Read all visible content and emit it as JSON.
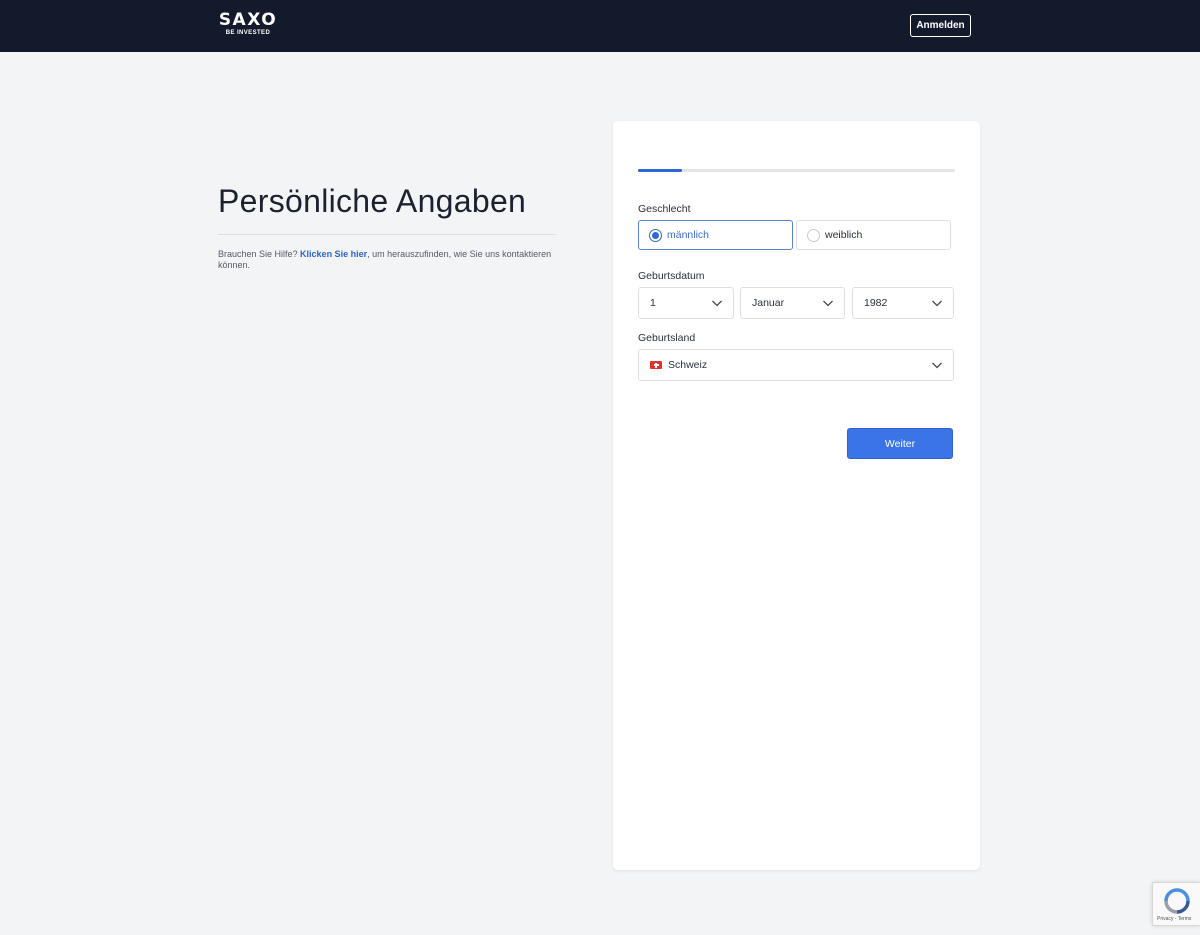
{
  "header": {
    "brand": "SAXO",
    "tagline": "BE INVESTED",
    "login_label": "Anmelden"
  },
  "intro": {
    "title": "Persönliche Angaben",
    "help_prefix": "Brauchen Sie Hilfe? ",
    "help_link": "Klicken Sie hier",
    "help_suffix": ", um herauszufinden, wie Sie uns kontaktieren können."
  },
  "form": {
    "progress": 0.14,
    "gender": {
      "label": "Geschlecht",
      "options": [
        "männlich",
        "weiblich"
      ],
      "selected": "männlich"
    },
    "birthdate": {
      "label": "Geburtsdatum",
      "day": "1",
      "month": "Januar",
      "year": "1982"
    },
    "birth_country": {
      "label": "Geburtsland",
      "value": "Schweiz",
      "flag": "swiss-flag-icon"
    },
    "next_label": "Weiter"
  },
  "recaptcha": {
    "footer": "Privacy - Terms"
  },
  "colors": {
    "topbar": "#131a2c",
    "accent": "#2c66d6",
    "button": "#3a74e6",
    "background": "#f3f4f6"
  }
}
